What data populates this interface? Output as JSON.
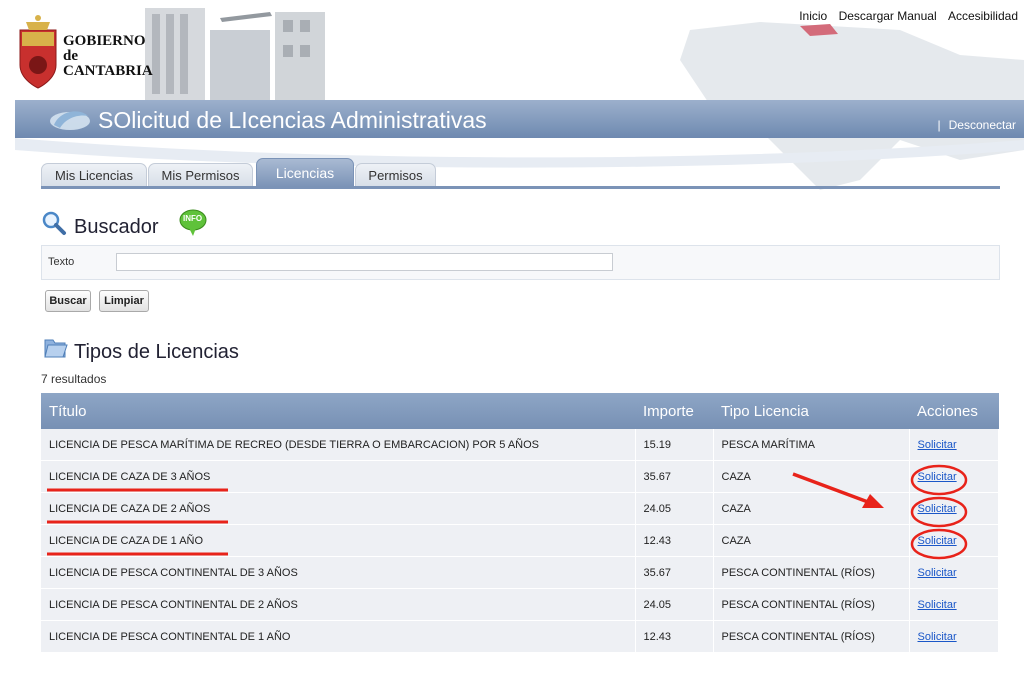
{
  "header": {
    "logo_lines": [
      "GOBIERNO",
      "de",
      "CANTABRIA"
    ],
    "top_links": [
      "Inicio",
      "Descargar Manual",
      "Accesibilidad"
    ],
    "app_title": "SOlicitud de LIcencias Administrativas",
    "logout_separator": "|",
    "logout_label": "Desconectar"
  },
  "tabs": [
    {
      "label": "Mis Licencias",
      "active": false
    },
    {
      "label": "Mis Permisos",
      "active": false
    },
    {
      "label": "Licencias",
      "active": true
    },
    {
      "label": "Permisos",
      "active": false
    }
  ],
  "search": {
    "title": "Buscador",
    "info_badge": "INFO",
    "field_label": "Texto",
    "field_value": "",
    "search_button": "Buscar",
    "clear_button": "Limpiar"
  },
  "licenses": {
    "title": "Tipos de Licencias",
    "result_count": "7 resultados",
    "columns": [
      "Título",
      "Importe",
      "Tipo Licencia",
      "Acciones"
    ],
    "rows": [
      {
        "titulo": "LICENCIA DE PESCA MARÍTIMA DE RECREO (DESDE TIERRA O EMBARCACION) POR 5 AÑOS",
        "importe": "15.19",
        "tipo": "PESCA MARÍTIMA",
        "accion": "Solicitar"
      },
      {
        "titulo": "LICENCIA DE CAZA DE 3 AÑOS",
        "importe": "35.67",
        "tipo": "CAZA",
        "accion": "Solicitar"
      },
      {
        "titulo": "LICENCIA DE CAZA DE 2 AÑOS",
        "importe": "24.05",
        "tipo": "CAZA",
        "accion": "Solicitar"
      },
      {
        "titulo": "LICENCIA DE CAZA DE 1 AÑO",
        "importe": "12.43",
        "tipo": "CAZA",
        "accion": "Solicitar"
      },
      {
        "titulo": "LICENCIA DE PESCA CONTINENTAL DE 3 AÑOS",
        "importe": "35.67",
        "tipo": "PESCA CONTINENTAL (RÍOS)",
        "accion": "Solicitar"
      },
      {
        "titulo": "LICENCIA DE PESCA CONTINENTAL DE 2 AÑOS",
        "importe": "24.05",
        "tipo": "PESCA CONTINENTAL (RÍOS)",
        "accion": "Solicitar"
      },
      {
        "titulo": "LICENCIA DE PESCA CONTINENTAL DE 1 AÑO",
        "importe": "12.43",
        "tipo": "PESCA CONTINENTAL (RÍOS)",
        "accion": "Solicitar"
      }
    ]
  },
  "colors": {
    "banner": "#7b93b7",
    "table_header": "#8ea6c6",
    "link": "#1a57c8",
    "annotation": "#e8231a"
  }
}
